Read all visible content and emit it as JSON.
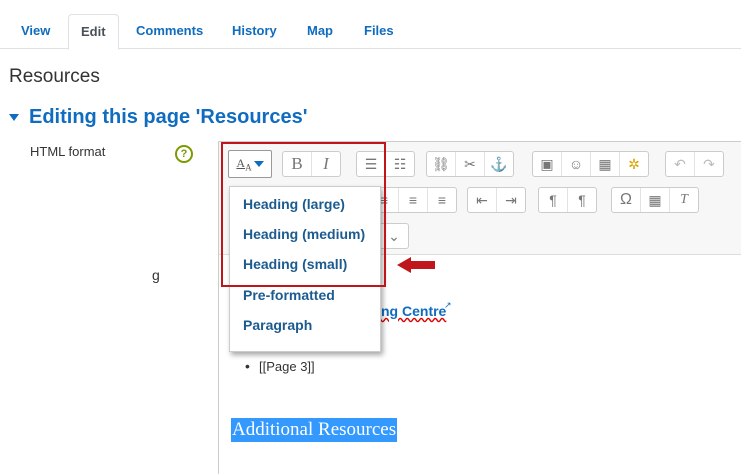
{
  "tabs": [
    {
      "label": "View"
    },
    {
      "label": "Edit"
    },
    {
      "label": "Comments"
    },
    {
      "label": "History"
    },
    {
      "label": "Map"
    },
    {
      "label": "Files"
    }
  ],
  "page_title": "Resources",
  "section_heading": "Editing this page 'Resources'",
  "field": {
    "label": "HTML format",
    "help_icon": "?"
  },
  "dropdown": {
    "items": [
      {
        "label": "Heading (large)"
      },
      {
        "label": "Heading (medium)"
      },
      {
        "label": "Heading (small)"
      },
      {
        "label": "Pre-formatted"
      },
      {
        "label": "Paragraph"
      }
    ]
  },
  "content": {
    "fragment_1": "g",
    "fragment_2": "ng Centre",
    "bullet": "[[Page 3]]",
    "selected_heading": "Additional Resources"
  },
  "colors": {
    "accent": "#0f6cbf",
    "annotation": "#c0151b",
    "selection": "#3399ff"
  }
}
